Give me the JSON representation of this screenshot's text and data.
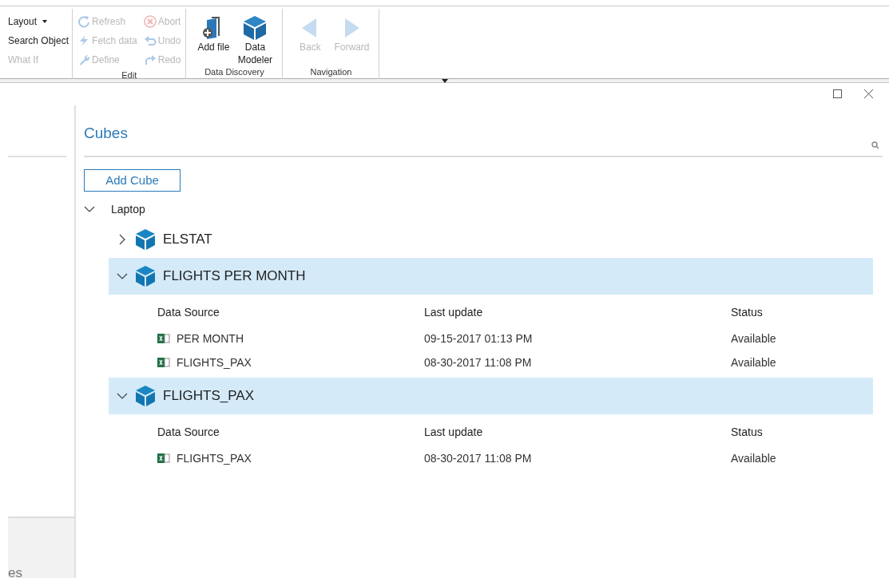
{
  "ribbon": {
    "groups": [
      {
        "kind": "small",
        "buttons": [
          {
            "label": "Layout",
            "disabled": false
          },
          {
            "label": "Search Object",
            "disabled": false
          },
          {
            "label": "What If",
            "disabled": true
          }
        ]
      },
      {
        "label": "Edit",
        "kind": "small",
        "buttons": [
          {
            "label": "Refresh",
            "disabled": true
          },
          {
            "label": "Fetch data",
            "disabled": true
          },
          {
            "label": "Define",
            "disabled": true
          },
          {
            "label": "Abort",
            "disabled": true
          },
          {
            "label": "Undo",
            "disabled": true
          },
          {
            "label": "Redo",
            "disabled": true
          }
        ]
      },
      {
        "label": "Data Discovery",
        "kind": "large",
        "buttons": [
          {
            "label": "Add file",
            "disabled": false
          },
          {
            "label": "Data Modeler",
            "disabled": false
          }
        ]
      },
      {
        "label": "Navigation",
        "kind": "large",
        "buttons": [
          {
            "label": "Back",
            "disabled": true
          },
          {
            "label": "Forward",
            "disabled": true
          }
        ]
      }
    ]
  },
  "side_panel": {
    "bottom_text": "es"
  },
  "cubes": {
    "title": "Cubes",
    "add_button": "Add Cube",
    "tree": {
      "label": "Laptop",
      "expanded": true,
      "children": [
        {
          "label": "ELSTAT",
          "expanded": false
        },
        {
          "label": "FLIGHTS PER MONTH",
          "expanded": true,
          "columns": [
            "Data Source",
            "Last update",
            "Status"
          ],
          "rows": [
            [
              "PER MONTH",
              "09-15-2017 01:13 PM",
              "Available"
            ],
            [
              "FLIGHTS_PAX",
              "08-30-2017 11:08 PM",
              "Available"
            ]
          ]
        },
        {
          "label": "FLIGHTS_PAX",
          "expanded": true,
          "columns": [
            "Data Source",
            "Last update",
            "Status"
          ],
          "rows": [
            [
              "FLIGHTS_PAX",
              "08-30-2017 11:08 PM",
              "Available"
            ]
          ]
        }
      ]
    }
  }
}
